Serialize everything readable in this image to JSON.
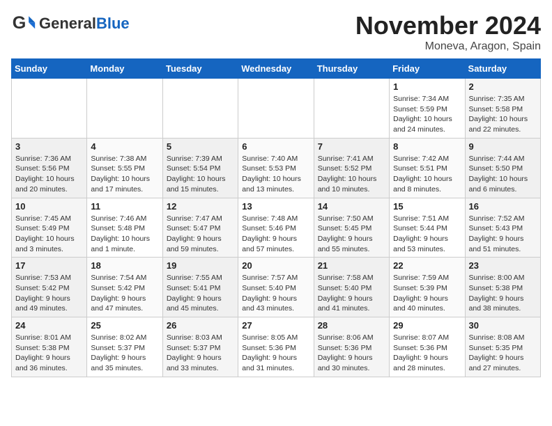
{
  "header": {
    "logo_general": "General",
    "logo_blue": "Blue",
    "month_title": "November 2024",
    "subtitle": "Moneva, Aragon, Spain"
  },
  "weekdays": [
    "Sunday",
    "Monday",
    "Tuesday",
    "Wednesday",
    "Thursday",
    "Friday",
    "Saturday"
  ],
  "weeks": [
    [
      {
        "day": "",
        "info": ""
      },
      {
        "day": "",
        "info": ""
      },
      {
        "day": "",
        "info": ""
      },
      {
        "day": "",
        "info": ""
      },
      {
        "day": "",
        "info": ""
      },
      {
        "day": "1",
        "info": "Sunrise: 7:34 AM\nSunset: 5:59 PM\nDaylight: 10 hours and 24 minutes."
      },
      {
        "day": "2",
        "info": "Sunrise: 7:35 AM\nSunset: 5:58 PM\nDaylight: 10 hours and 22 minutes."
      }
    ],
    [
      {
        "day": "3",
        "info": "Sunrise: 7:36 AM\nSunset: 5:56 PM\nDaylight: 10 hours and 20 minutes."
      },
      {
        "day": "4",
        "info": "Sunrise: 7:38 AM\nSunset: 5:55 PM\nDaylight: 10 hours and 17 minutes."
      },
      {
        "day": "5",
        "info": "Sunrise: 7:39 AM\nSunset: 5:54 PM\nDaylight: 10 hours and 15 minutes."
      },
      {
        "day": "6",
        "info": "Sunrise: 7:40 AM\nSunset: 5:53 PM\nDaylight: 10 hours and 13 minutes."
      },
      {
        "day": "7",
        "info": "Sunrise: 7:41 AM\nSunset: 5:52 PM\nDaylight: 10 hours and 10 minutes."
      },
      {
        "day": "8",
        "info": "Sunrise: 7:42 AM\nSunset: 5:51 PM\nDaylight: 10 hours and 8 minutes."
      },
      {
        "day": "9",
        "info": "Sunrise: 7:44 AM\nSunset: 5:50 PM\nDaylight: 10 hours and 6 minutes."
      }
    ],
    [
      {
        "day": "10",
        "info": "Sunrise: 7:45 AM\nSunset: 5:49 PM\nDaylight: 10 hours and 3 minutes."
      },
      {
        "day": "11",
        "info": "Sunrise: 7:46 AM\nSunset: 5:48 PM\nDaylight: 10 hours and 1 minute."
      },
      {
        "day": "12",
        "info": "Sunrise: 7:47 AM\nSunset: 5:47 PM\nDaylight: 9 hours and 59 minutes."
      },
      {
        "day": "13",
        "info": "Sunrise: 7:48 AM\nSunset: 5:46 PM\nDaylight: 9 hours and 57 minutes."
      },
      {
        "day": "14",
        "info": "Sunrise: 7:50 AM\nSunset: 5:45 PM\nDaylight: 9 hours and 55 minutes."
      },
      {
        "day": "15",
        "info": "Sunrise: 7:51 AM\nSunset: 5:44 PM\nDaylight: 9 hours and 53 minutes."
      },
      {
        "day": "16",
        "info": "Sunrise: 7:52 AM\nSunset: 5:43 PM\nDaylight: 9 hours and 51 minutes."
      }
    ],
    [
      {
        "day": "17",
        "info": "Sunrise: 7:53 AM\nSunset: 5:42 PM\nDaylight: 9 hours and 49 minutes."
      },
      {
        "day": "18",
        "info": "Sunrise: 7:54 AM\nSunset: 5:42 PM\nDaylight: 9 hours and 47 minutes."
      },
      {
        "day": "19",
        "info": "Sunrise: 7:55 AM\nSunset: 5:41 PM\nDaylight: 9 hours and 45 minutes."
      },
      {
        "day": "20",
        "info": "Sunrise: 7:57 AM\nSunset: 5:40 PM\nDaylight: 9 hours and 43 minutes."
      },
      {
        "day": "21",
        "info": "Sunrise: 7:58 AM\nSunset: 5:40 PM\nDaylight: 9 hours and 41 minutes."
      },
      {
        "day": "22",
        "info": "Sunrise: 7:59 AM\nSunset: 5:39 PM\nDaylight: 9 hours and 40 minutes."
      },
      {
        "day": "23",
        "info": "Sunrise: 8:00 AM\nSunset: 5:38 PM\nDaylight: 9 hours and 38 minutes."
      }
    ],
    [
      {
        "day": "24",
        "info": "Sunrise: 8:01 AM\nSunset: 5:38 PM\nDaylight: 9 hours and 36 minutes."
      },
      {
        "day": "25",
        "info": "Sunrise: 8:02 AM\nSunset: 5:37 PM\nDaylight: 9 hours and 35 minutes."
      },
      {
        "day": "26",
        "info": "Sunrise: 8:03 AM\nSunset: 5:37 PM\nDaylight: 9 hours and 33 minutes."
      },
      {
        "day": "27",
        "info": "Sunrise: 8:05 AM\nSunset: 5:36 PM\nDaylight: 9 hours and 31 minutes."
      },
      {
        "day": "28",
        "info": "Sunrise: 8:06 AM\nSunset: 5:36 PM\nDaylight: 9 hours and 30 minutes."
      },
      {
        "day": "29",
        "info": "Sunrise: 8:07 AM\nSunset: 5:36 PM\nDaylight: 9 hours and 28 minutes."
      },
      {
        "day": "30",
        "info": "Sunrise: 8:08 AM\nSunset: 5:35 PM\nDaylight: 9 hours and 27 minutes."
      }
    ]
  ]
}
